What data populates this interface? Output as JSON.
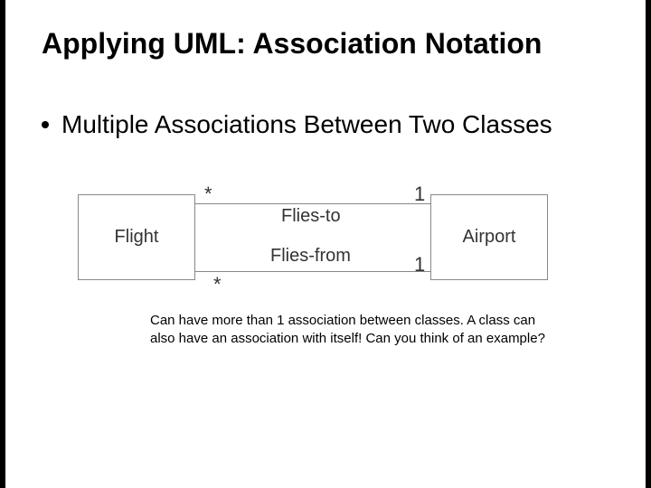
{
  "title": "Applying UML: Association Notation",
  "bullet": "Multiple Associations Between Two Classes",
  "diagram": {
    "class_left": "Flight",
    "class_right": "Airport",
    "associations": [
      {
        "label": "Flies-to",
        "mult_left": "*",
        "mult_right": "1"
      },
      {
        "label": "Flies-from",
        "mult_left": "*",
        "mult_right": "1"
      }
    ]
  },
  "caption": "Can have more than 1 association between classes. A class can also have an association with itself! Can you think of an example?"
}
